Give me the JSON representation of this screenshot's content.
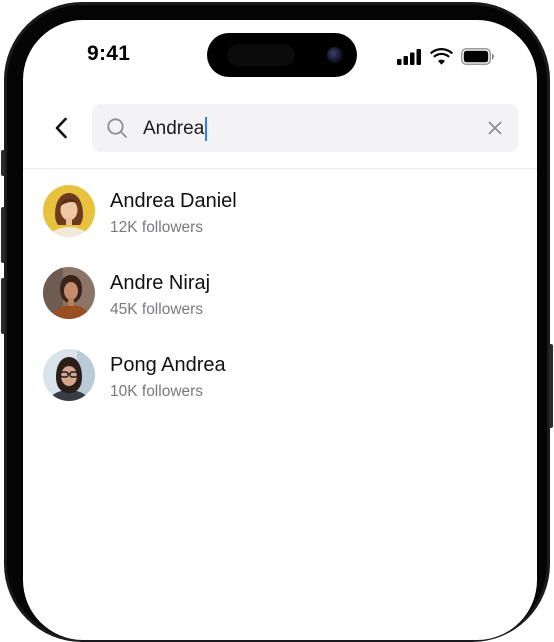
{
  "status_bar": {
    "time": "9:41"
  },
  "search": {
    "query": "Andrea",
    "caret_color": "#2f7cf6"
  },
  "icons": {
    "back": "chevron-left-icon",
    "search": "magnifier-icon",
    "clear": "close-icon",
    "signal": "cellular-signal-icon",
    "wifi": "wifi-icon",
    "battery": "battery-icon"
  },
  "results": [
    {
      "name": "Andrea Daniel",
      "followers": "12K followers"
    },
    {
      "name": "Andre Niraj",
      "followers": "45K followers"
    },
    {
      "name": "Pong Andrea",
      "followers": "10K followers"
    }
  ]
}
